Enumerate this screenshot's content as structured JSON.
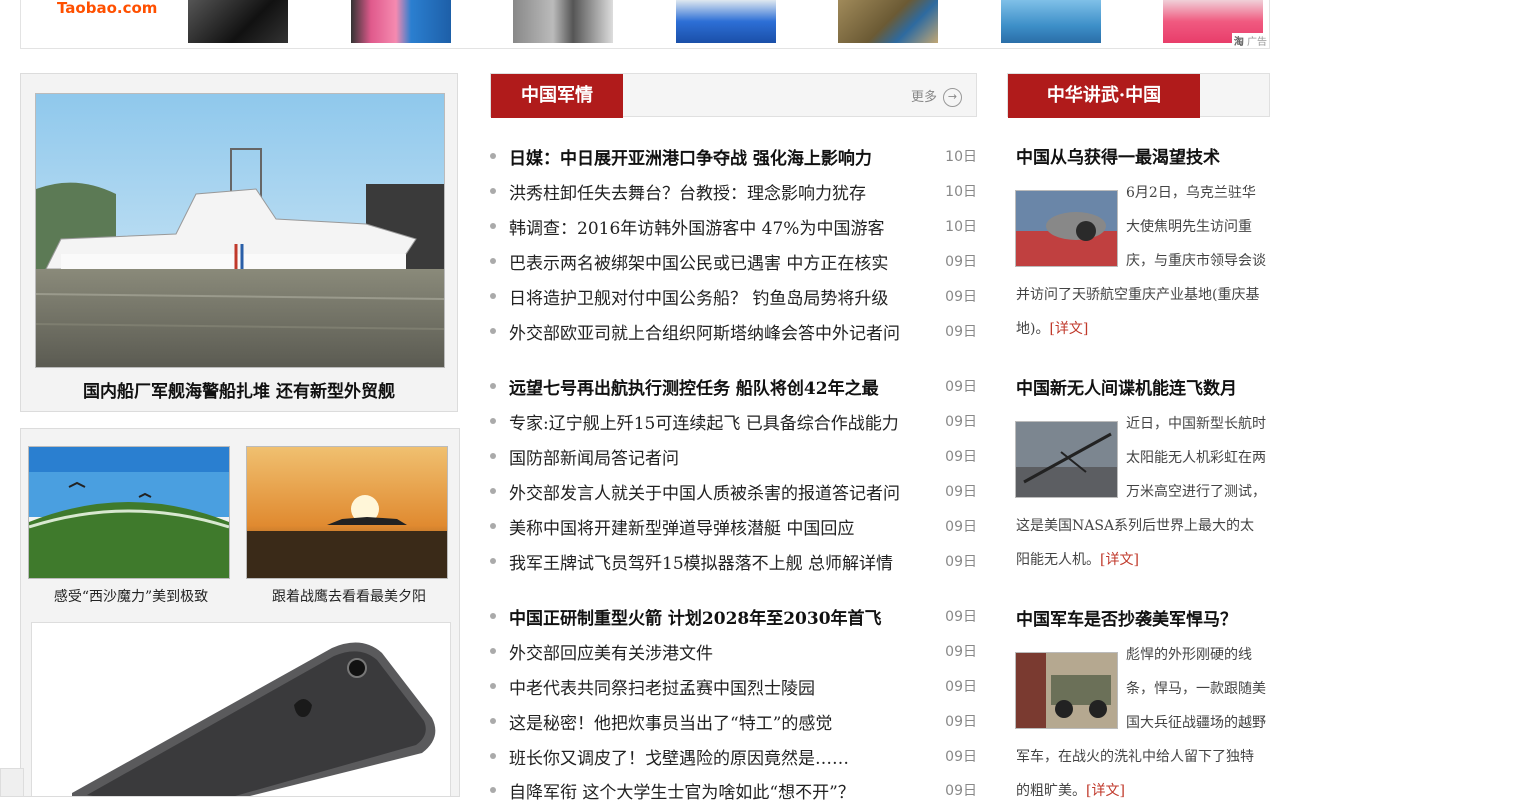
{
  "ad": {
    "logo": "Taobao.com",
    "mark_logo": "淘",
    "mark_label": "广告",
    "thumbs": [
      "black-slippers-icon",
      "pink-slippers-icon",
      "gray-carpet-icon",
      "blue-slippers-icon",
      "outdoor-shoe-icon",
      "blue-towel-icon",
      "pink-slippers-icon"
    ]
  },
  "feature": {
    "caption": "国内船厂军舰海警船扎堆 还有新型外贸舰"
  },
  "gallery": {
    "items": [
      {
        "caption": "感受“西沙魔力”美到极致"
      },
      {
        "caption": "跟着战鹰去看看最美夕阳"
      }
    ]
  },
  "military": {
    "title": "中国军情",
    "more": "更多",
    "groups": [
      [
        {
          "text": "日媒：中日展开亚洲港口争夺战 强化海上影响力",
          "date": "10日",
          "strong": true
        },
        {
          "text": "洪秀柱卸任失去舞台？台教授：理念影响力犹存",
          "date": "10日"
        },
        {
          "text": "韩调查：2016年访韩外国游客中 47%为中国游客",
          "date": "10日"
        },
        {
          "text": "巴表示两名被绑架中国公民或已遇害 中方正在核实",
          "date": "09日"
        },
        {
          "text": "日将造护卫舰对付中国公务船？ 钓鱼岛局势将升级",
          "date": "09日"
        },
        {
          "text": "外交部欧亚司就上合组织阿斯塔纳峰会答中外记者问",
          "date": "09日"
        }
      ],
      [
        {
          "text": "远望七号再出航执行测控任务 船队将创42年之最",
          "date": "09日",
          "strong": true
        },
        {
          "text": "专家:辽宁舰上歼15可连续起飞 已具备综合作战能力",
          "date": "09日"
        },
        {
          "text": "国防部新闻局答记者问",
          "date": "09日"
        },
        {
          "text": "外交部发言人就关于中国人质被杀害的报道答记者问",
          "date": "09日"
        },
        {
          "text": "美称中国将开建新型弹道导弹核潜艇 中国回应",
          "date": "09日"
        },
        {
          "text": "我军王牌试飞员驾歼15模拟器落不上舰 总师解详情",
          "date": "09日"
        }
      ],
      [
        {
          "text": "中国正研制重型火箭 计划2028年至2030年首飞",
          "date": "09日",
          "strong": true
        },
        {
          "text": "外交部回应美有关涉港文件",
          "date": "09日"
        },
        {
          "text": "中老代表共同祭扫老挝孟赛中国烈士陵园",
          "date": "09日"
        },
        {
          "text": "这是秘密！他把炊事员当出了“特工”的感觉",
          "date": "09日"
        },
        {
          "text": "班长你又调皮了！戈壁遇险的原因竟然是……",
          "date": "09日"
        },
        {
          "text": "自降军衔 这个大学生士官为啥如此“想不开”？",
          "date": "09日"
        }
      ]
    ]
  },
  "china": {
    "title": "中华讲武·中国",
    "read_more": "[详文]",
    "articles": [
      {
        "title": "中国从乌获得一最渴望技术",
        "body": "6月2日，乌克兰驻华大使焦明先生访问重庆，与重庆市领导会谈并访问了天骄航空重庆产业基地(重庆基地)。"
      },
      {
        "title": "中国新无人间谍机能连飞数月",
        "body": "近日，中国新型长航时太阳能无人机彩虹在两万米高空进行了测试，这是美国NASA系列后世界上最大的太阳能无人机。"
      },
      {
        "title": "中国军车是否抄袭美军悍马？",
        "body": "彪悍的外形刚硬的线条，悍马，一款跟随美国大兵征战疆场的越野军车，在战火的洗礼中给人留下了独特的粗旷美。"
      }
    ]
  }
}
